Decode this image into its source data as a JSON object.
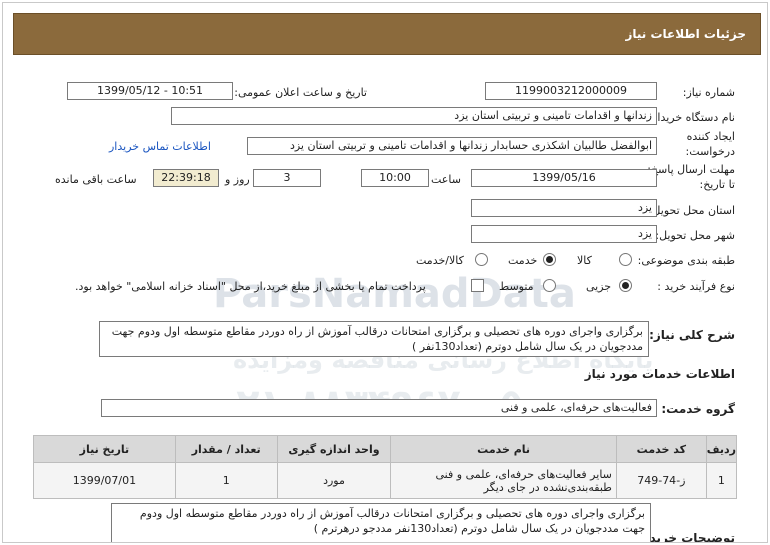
{
  "header": {
    "title": "جزئیات اطلاعات نیاز"
  },
  "form": {
    "need_number_label": "شماره نیاز:",
    "need_number": "1199003212000009",
    "announce_label": "تاریخ و ساعت اعلان عمومی:",
    "announce_value": "1399/05/12 - 10:51",
    "buyer_org_label": "نام دستگاه خریدار:",
    "buyer_org": "زندانها و اقدامات تامینی و تربیتی استان یزد",
    "creator_label": "ایجاد کننده درخواست:",
    "creator": "ابوالفضل  طالبیان اشکذری حسابدار زندانها و اقدامات تامینی و تربیتی استان یزد",
    "contact_link": "اطلاعات تماس خریدار",
    "deadline_label": "مهلت ارسال پاسخ: تا تاریخ:",
    "deadline_date": "1399/05/16",
    "time_label": "ساعت",
    "deadline_time": "10:00",
    "days_value": "3",
    "days_label": "روز و",
    "remaining_time": "22:39:18",
    "remaining_label": "ساعت باقی مانده",
    "province_label": "استان محل تحویل:",
    "province": "یزد",
    "city_label": "شهر محل تحویل:",
    "city": "یزد",
    "category_label": "طبقه بندی موضوعی:",
    "category_options": [
      "کالا",
      "خدمت",
      "کالا/خدمت"
    ],
    "category_selected": "خدمت",
    "process_label": "نوع فرآیند خرید :",
    "process_options": [
      "جزیی",
      "متوسط"
    ],
    "process_selected": "جزیی",
    "payment_note": "پرداخت تمام یا بخشی از مبلغ خرید،از محل \"اسناد خزانه اسلامی\" خواهد بود.",
    "summary_label": "شرح کلی نیاز:",
    "summary": "برگزاری واجرای دوره های تحصیلی و برگزاری امتحانات درقالب آموزش از راه دوردر مقاطع متوسطه اول ودوم جهت مددجویان در یک سال شامل دوترم (تعداد130نفر )"
  },
  "services": {
    "section_title": "اطلاعات خدمات مورد نیاز",
    "group_label": "گروه خدمت:",
    "group_value": "فعالیت‌های حرفه‌ای، علمی و فنی",
    "columns": [
      "ردیف",
      "کد خدمت",
      "نام خدمت",
      "واحد اندازه گیری",
      "تعداد / مقدار",
      "تاریخ نیاز"
    ],
    "rows": [
      {
        "index": "1",
        "code": "ز-74-749",
        "name": "سایر فعالیت‌های حرفه‌ای، علمی و فنی طبقه‌بندی‌نشده در جای دیگر",
        "unit": "مورد",
        "qty": "1",
        "date": "1399/07/01"
      }
    ],
    "buyer_notes_label": "توضیحات خریدار:",
    "buyer_notes": "برگزاری واجرای دوره های تحصیلی و برگزاری امتحانات درقالب آموزش از راه دوردر مقاطع متوسطه اول ودوم جهت مددجویان در یک سال شامل دوترم (تعداد130نفر مددجو درهرترم )"
  },
  "watermark": {
    "site": "ParsNamadData",
    "slogan": "پایگاه اطلاع رسانی مناقصه ومزایده",
    "phone": "۰۲۱-۸۸۳۴۹۶۷۰-۵"
  }
}
